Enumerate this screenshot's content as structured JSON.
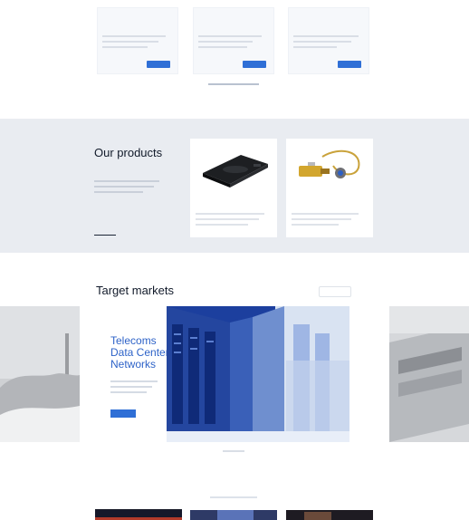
{
  "news": {
    "cards": [
      {
        "title_line1": "",
        "title_line2": "",
        "button": ""
      },
      {
        "title_line1": "",
        "title_line2": "",
        "button": ""
      },
      {
        "title_line1": "",
        "title_line2": "",
        "button": ""
      }
    ],
    "see_all": ""
  },
  "products": {
    "eyebrow": "",
    "title": "Our products",
    "link": "",
    "cards": [
      {
        "title_line1": "",
        "title_line2": "",
        "image": "black-network-module"
      },
      {
        "title_line1": "",
        "title_line2": "",
        "image": "gold-fiber-connector"
      }
    ]
  },
  "markets": {
    "title": "Target markets",
    "more_button": "",
    "slide_heading": [
      "Telecoms",
      "Data Centers",
      "Networks"
    ],
    "slide_button": "",
    "slide_image": "server-racks-photo"
  },
  "colors": {
    "accent_blue": "#2f6fd6",
    "heading_blue": "#2e63c8",
    "band_gray": "#e9ecf1",
    "text_dark": "#111a2a"
  }
}
